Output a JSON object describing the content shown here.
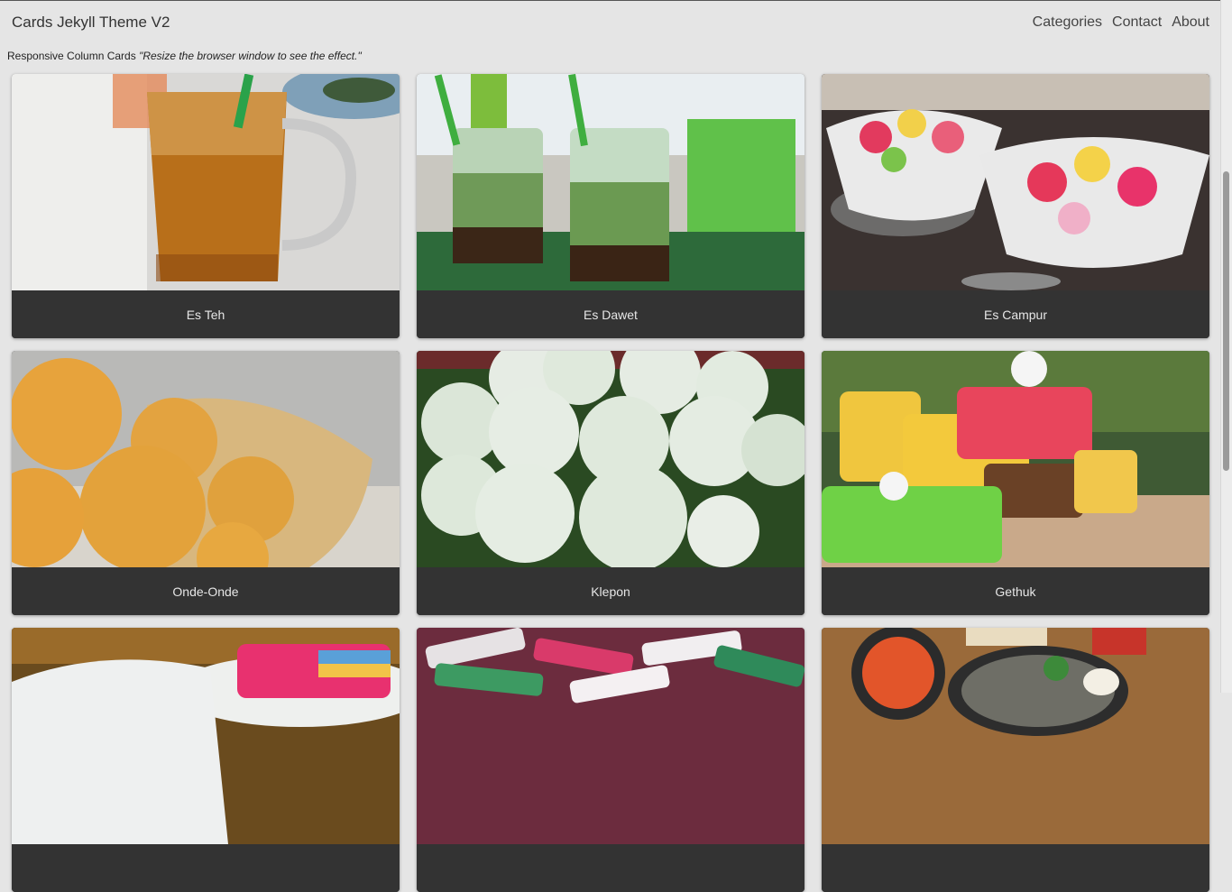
{
  "header": {
    "brand": "Cards Jekyll Theme V2",
    "nav": [
      "Categories",
      "Contact",
      "About"
    ]
  },
  "subtitle": {
    "prefix": "Responsive Column Cards ",
    "note": "\"Resize the browser window to see the effect.\""
  },
  "cards": [
    {
      "title": "Es Teh",
      "image": "es-teh-photo"
    },
    {
      "title": "Es Dawet",
      "image": "es-dawet-photo"
    },
    {
      "title": "Es Campur",
      "image": "es-campur-photo"
    },
    {
      "title": "Onde-Onde",
      "image": "onde-onde-photo"
    },
    {
      "title": "Klepon",
      "image": "klepon-photo"
    },
    {
      "title": "Gethuk",
      "image": "gethuk-photo"
    },
    {
      "title": "",
      "image": "kue-lapis-photo"
    },
    {
      "title": "",
      "image": "wrapped-sweets-photo"
    },
    {
      "title": "",
      "image": "sambal-dish-photo"
    }
  ]
}
